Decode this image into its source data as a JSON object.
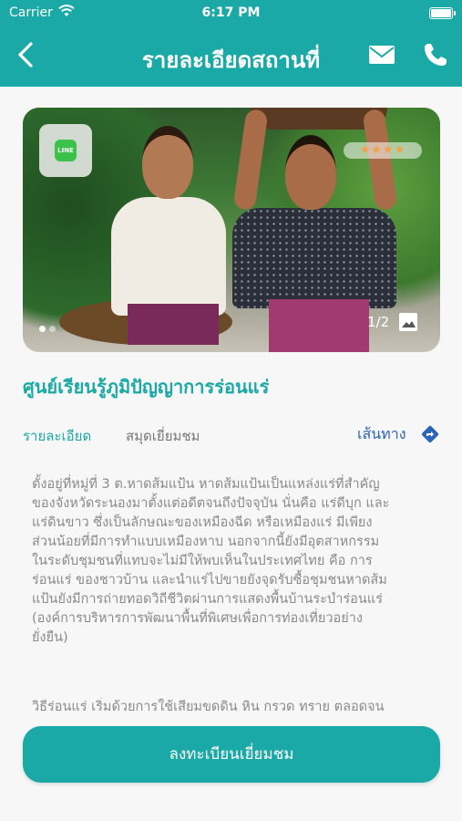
{
  "status_bar": {
    "carrier": "Carrier",
    "time": "6:17 PM"
  },
  "nav": {
    "title": "รายละเอียดสถานที่",
    "icons": [
      "back-icon",
      "mail-icon",
      "phone-icon"
    ]
  },
  "hero": {
    "rating_stars": "★★★★",
    "rating_value": 4,
    "rating_max": 5,
    "counter": "1/2",
    "line_label": "LINE",
    "dots_total": 2,
    "active_dot": 1
  },
  "place_name": "ศูนย์เรียนรู้ภูมิปัญญาการร่อนแร่",
  "tabs": {
    "details": "รายละเอียด",
    "guestbook": "สมุดเยี่ยมชม",
    "route": "เส้นทาง"
  },
  "description": "ตั้งอยู่ที่หมู่ที่ 3 ต.หาดส้มแป้น หาดส้มแป้นเป็นแหล่งแร่ที่สำคัญ\nของจังหวัดระนองมาตั้งแต่อดีตจนถึงปัจจุบัน นั่นคือ แร่ดีบุก และ\nแร่ดินขาว ซึ่งเป็นลักษณะของเหมืองฉีด หรือเหมืองแร่ มีเพียง\nส่วนน้อยที่มีการทำแบบเหมืองหาบ นอกจากนี้ยังมีอุตสาหกรรม\nในระดับชุมชนที่แทบจะไม่มีให้พบเห็นในประเทศไทย คือ การ\nร่อนแร่ ของชาวบ้าน และนำแร่ไปขายยังจุดรับซื้อชุมชนหาดส้ม\nแป้นยังมีการถ่ายทอดวิถีชีวิตผ่านการแสดงพื้นบ้านระบำร่อนแร่\n(องค์การบริหารการพัฒนาพื้นที่พิเศษเพื่อการท่องเที่ยวอย่าง\nยั่งยืน)",
  "description_more": "วิธีร่อนแร่ เริ่มด้วยการใช้เสียมขุดดิน หิน กรวด ทราย ตลอดจน",
  "cta": "ลงทะเบียนเยี่ยมชม",
  "colors": {
    "primary": "#1aa9a6",
    "link": "#2b64b8",
    "star": "#f4a14b"
  }
}
